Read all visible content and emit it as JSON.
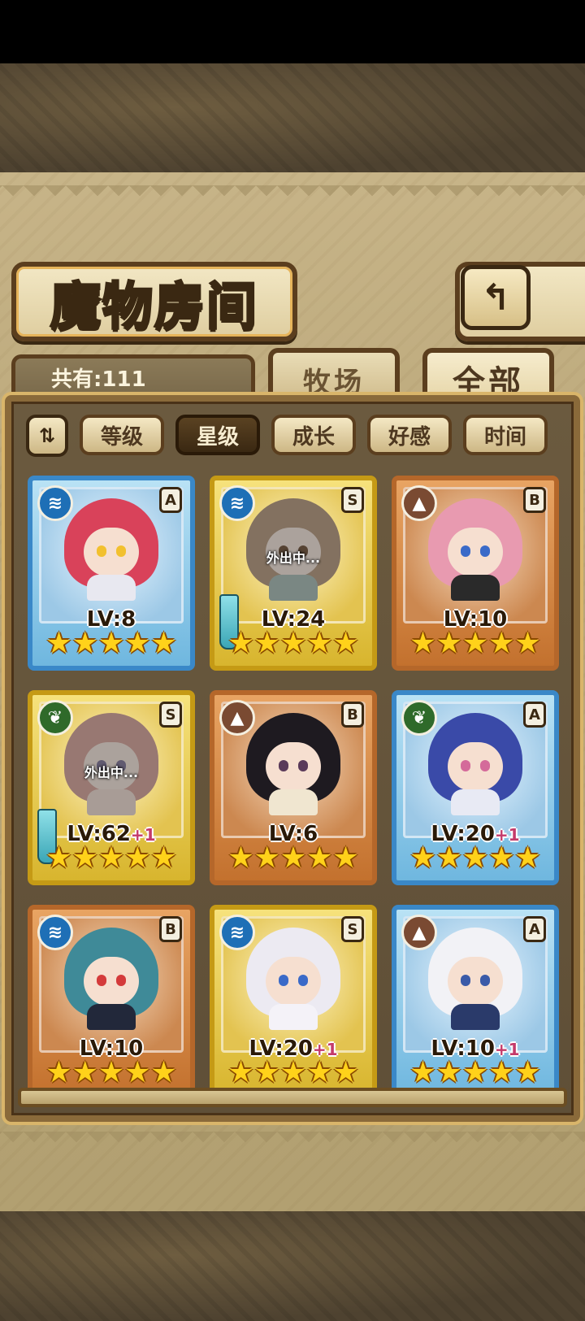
{
  "screen": {
    "title": "魔物房间",
    "back_glyph": "↰"
  },
  "header": {
    "count_label": "共有:111"
  },
  "tabs": [
    {
      "label": "牧场",
      "active": false
    },
    {
      "label": "全部",
      "active": true
    }
  ],
  "sort": {
    "toggle_glyph": "⇅",
    "buttons": [
      {
        "label": "等级",
        "active": false
      },
      {
        "label": "星级",
        "active": true
      },
      {
        "label": "成长",
        "active": false
      },
      {
        "label": "好感",
        "active": false
      },
      {
        "label": "时间",
        "active": false
      }
    ]
  },
  "monsters": [
    {
      "element": "water",
      "element_glyph": "≋",
      "rank": "A",
      "frame": "blue",
      "level": "LV:8",
      "plus": "",
      "stars": "★★★★★",
      "away": "",
      "hair": "#d9425a",
      "eye": "#f2c02e",
      "body": "#e8e8f0"
    },
    {
      "element": "water",
      "element_glyph": "≋",
      "rank": "S",
      "frame": "gold",
      "level": "LV:24",
      "plus": "",
      "stars": "★★★★★",
      "away": "外出中...",
      "hair": "#c79a70",
      "eye": "#8a5a30",
      "body": "#9fbfb5"
    },
    {
      "element": "earth",
      "element_glyph": "▲",
      "rank": "B",
      "frame": "bronze",
      "level": "LV:10",
      "plus": "",
      "stars": "★★★★★",
      "away": "",
      "hair": "#e89ab0",
      "eye": "#3a6ac8",
      "body": "#2a2a2a"
    },
    {
      "element": "leaf",
      "element_glyph": "❦",
      "rank": "S",
      "frame": "gold",
      "level": "LV:62",
      "plus": "+1",
      "stars": "★★★★★",
      "away": "外出中...",
      "hair": "#f0a090",
      "eye": "#8a7ab0",
      "body": "#f4d6c8"
    },
    {
      "element": "earth",
      "element_glyph": "▲",
      "rank": "B",
      "frame": "bronze",
      "level": "LV:6",
      "plus": "",
      "stars": "★★★★★",
      "away": "",
      "hair": "#1e1a20",
      "eye": "#5a3a5a",
      "body": "#f0e6d0"
    },
    {
      "element": "leaf",
      "element_glyph": "❦",
      "rank": "A",
      "frame": "blue",
      "level": "LV:20",
      "plus": "+1",
      "stars": "★★★★★",
      "away": "",
      "hair": "#3a4aa8",
      "eye": "#d46a9a",
      "body": "#e8eaf4"
    },
    {
      "element": "water",
      "element_glyph": "≋",
      "rank": "B",
      "frame": "bronze",
      "level": "LV:10",
      "plus": "",
      "stars": "★★★★★",
      "away": "",
      "hair": "#3f8a98",
      "eye": "#d43a3a",
      "body": "#22283a"
    },
    {
      "element": "water",
      "element_glyph": "≋",
      "rank": "S",
      "frame": "gold",
      "level": "LV:20",
      "plus": "+1",
      "stars": "★★★★★",
      "away": "",
      "hair": "#eceaf2",
      "eye": "#3a6ac8",
      "body": "#f4f2f8"
    },
    {
      "element": "earth",
      "element_glyph": "▲",
      "rank": "A",
      "frame": "blue",
      "level": "LV:10",
      "plus": "+1",
      "stars": "★★★★★",
      "away": "",
      "hair": "#f2f2f6",
      "eye": "#3a5aa8",
      "body": "#2a3a6a"
    }
  ]
}
